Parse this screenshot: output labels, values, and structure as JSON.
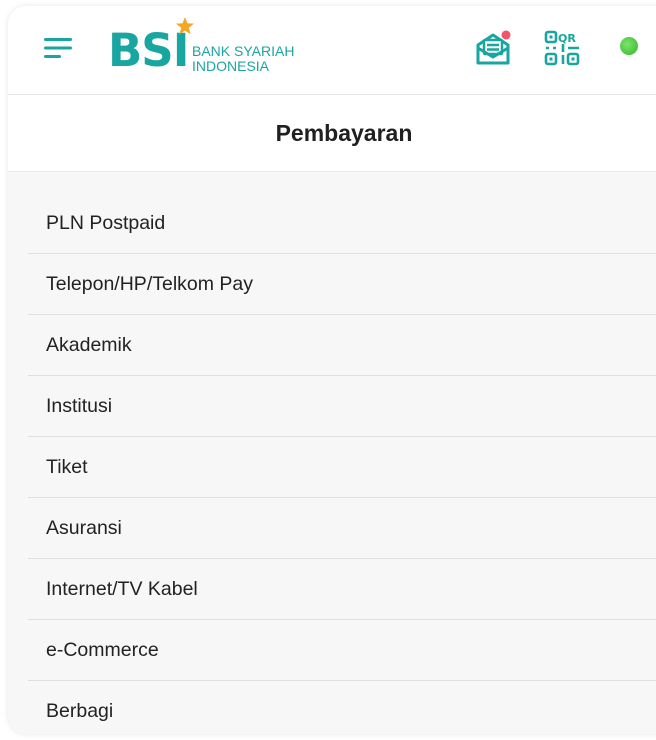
{
  "header": {
    "logo": {
      "mark": "BSI",
      "line1": "BANK SYARIAH",
      "line2": "INDONESIA"
    },
    "icons": [
      "menu-icon",
      "mail-icon",
      "qr-icon"
    ],
    "qr_label": "QR",
    "status_color": "#2fb62a",
    "notification_dot_color": "#f0556a"
  },
  "page": {
    "title": "Pembayaran"
  },
  "menu": {
    "items": [
      {
        "label": "PLN Postpaid"
      },
      {
        "label": "Telepon/HP/Telkom Pay"
      },
      {
        "label": "Akademik"
      },
      {
        "label": "Institusi"
      },
      {
        "label": "Tiket"
      },
      {
        "label": "Asuransi"
      },
      {
        "label": "Internet/TV Kabel"
      },
      {
        "label": "e-Commerce"
      },
      {
        "label": "Berbagi"
      }
    ]
  },
  "colors": {
    "brand": "#1aa6a0",
    "star": "#f5a623"
  }
}
